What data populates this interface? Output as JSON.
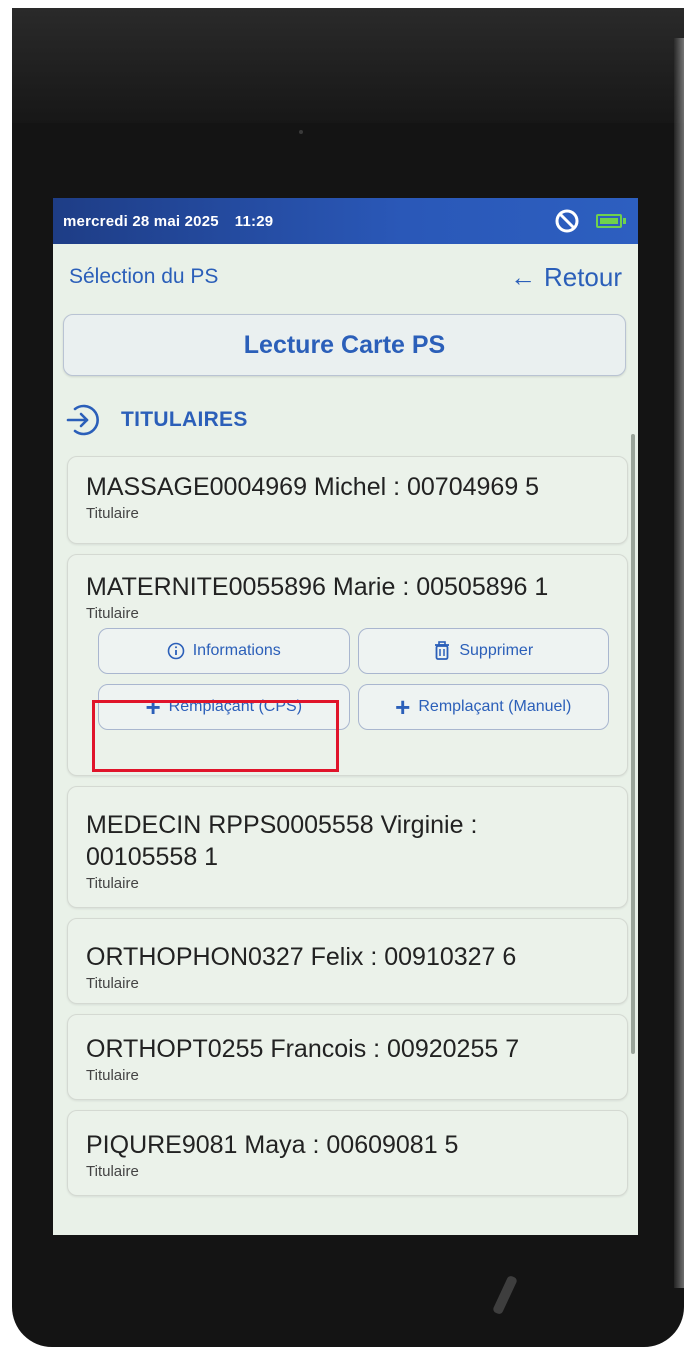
{
  "statusbar": {
    "date": "mercredi 28 mai 2025",
    "time": "11:29",
    "icons": [
      "no-entry-icon",
      "battery-icon"
    ],
    "bg_color": "#2a58b8",
    "battery_color": "#6fd14c"
  },
  "nav": {
    "title": "Sélection du PS",
    "back_arrow": "←",
    "back_label": "Retour"
  },
  "lecture_button": {
    "label": "Lecture Carte PS"
  },
  "section": {
    "label": "TITULAIRES",
    "icon": "login-arrow-icon"
  },
  "titulaires": [
    {
      "name": "MASSAGE0004969 Michel : 00704969 5",
      "role": "Titulaire"
    },
    {
      "name": "MATERNITE0055896 Marie : 00505896 1",
      "role": "Titulaire",
      "expanded": true,
      "actions": {
        "informations": "Informations",
        "supprimer": "Supprimer",
        "remplacant_cps": "Remplaçant (CPS)",
        "remplacant_manuel": "Remplaçant (Manuel)"
      }
    },
    {
      "name": "MEDECIN RPPS0005558 Virginie : 00105558 1",
      "role": "Titulaire"
    },
    {
      "name": "ORTHOPHON0327 Felix : 00910327 6",
      "role": "Titulaire"
    },
    {
      "name": "ORTHOPT0255 Francois : 00920255 7",
      "role": "Titulaire"
    },
    {
      "name": "PIQURE9081 Maya : 00609081 5",
      "role": "Titulaire"
    }
  ],
  "colors": {
    "accent": "#2b5fb9",
    "screen_bg": "#e9f1e8",
    "highlight": "#e0142a"
  }
}
